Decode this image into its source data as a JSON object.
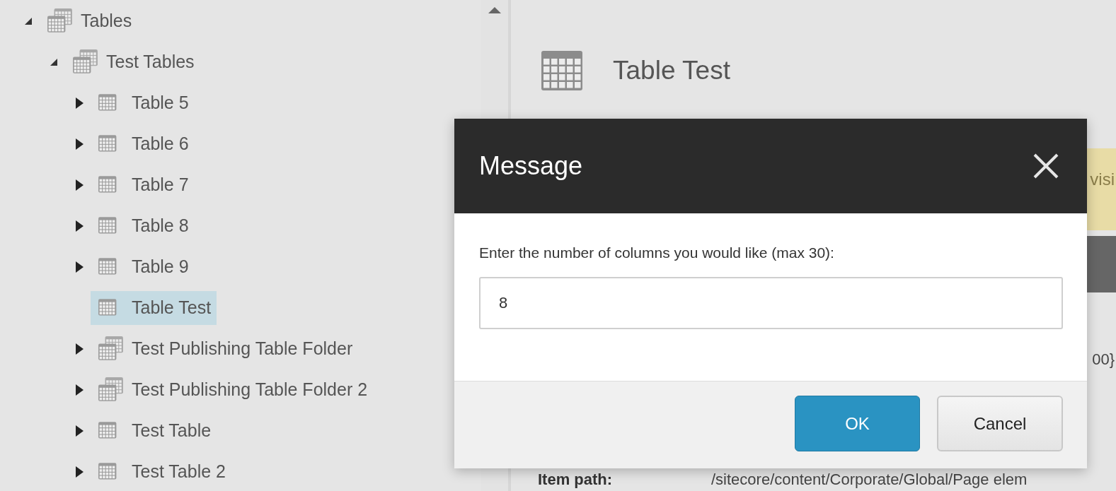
{
  "tree": [
    {
      "label": "Tables",
      "kind": "folder",
      "expandable": true,
      "expanded": true,
      "selected": false,
      "children": [
        {
          "label": "Test Tables",
          "kind": "folder",
          "expandable": true,
          "expanded": true,
          "selected": false,
          "children": [
            {
              "label": "Table 5",
              "kind": "table",
              "expandable": true,
              "expanded": false,
              "selected": false
            },
            {
              "label": "Table 6",
              "kind": "table",
              "expandable": true,
              "expanded": false,
              "selected": false
            },
            {
              "label": "Table 7",
              "kind": "table",
              "expandable": true,
              "expanded": false,
              "selected": false
            },
            {
              "label": "Table 8",
              "kind": "table",
              "expandable": true,
              "expanded": false,
              "selected": false
            },
            {
              "label": "Table 9",
              "kind": "table",
              "expandable": true,
              "expanded": false,
              "selected": false
            },
            {
              "label": "Table Test",
              "kind": "table",
              "expandable": false,
              "selected": true
            },
            {
              "label": "Test Publishing Table Folder",
              "kind": "folder",
              "expandable": true,
              "expanded": false,
              "selected": false
            },
            {
              "label": "Test Publishing Table Folder 2",
              "kind": "folder",
              "expandable": true,
              "expanded": false,
              "selected": false
            },
            {
              "label": "Test Table",
              "kind": "table",
              "expandable": true,
              "expanded": false,
              "selected": false
            },
            {
              "label": "Test Table 2",
              "kind": "table",
              "expandable": true,
              "expanded": false,
              "selected": false
            }
          ]
        }
      ]
    }
  ],
  "item": {
    "title": "Table Test",
    "notice_fragment": "visi",
    "id_fragment": "00}",
    "path_label": "Item path:",
    "path_value": "/sitecore/content/Corporate/Global/Page elem"
  },
  "dialog": {
    "title": "Message",
    "prompt": "Enter the number of columns you would like (max 30):",
    "value": "8",
    "buttons": [
      {
        "label": "OK",
        "kind": "primary"
      },
      {
        "label": "Cancel",
        "kind": "secondary"
      }
    ]
  }
}
